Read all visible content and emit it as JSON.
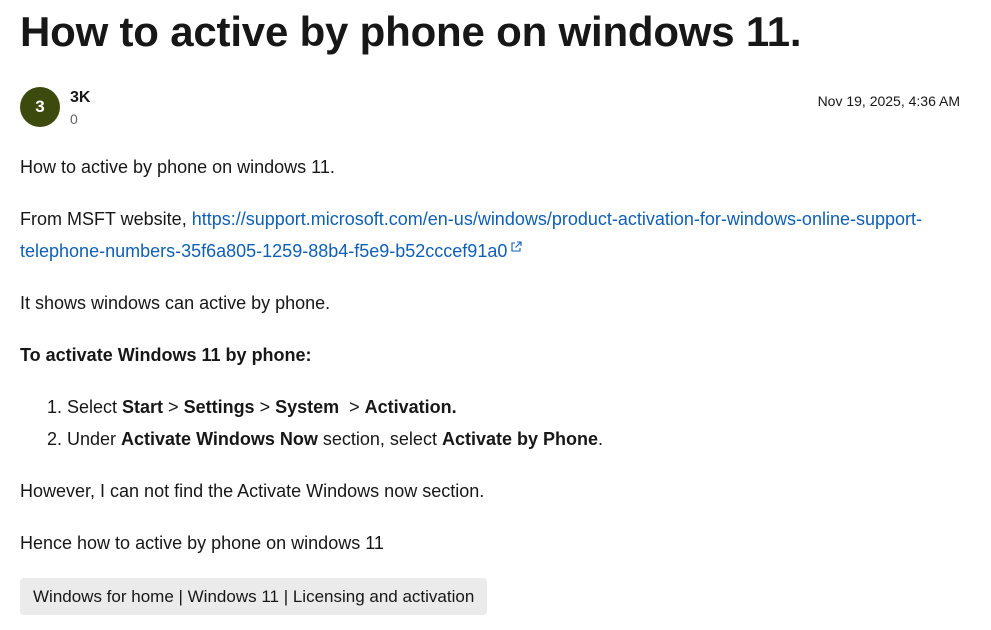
{
  "question": {
    "title": "How to active by phone on windows 11."
  },
  "author": {
    "avatar_initial": "3",
    "name": "3K",
    "reputation": "0",
    "date": "Nov 19, 2025, 4:36 AM"
  },
  "body": {
    "p1": "How to active by phone on windows 11.",
    "p2_prefix": "From MSFT website, ",
    "p2_link": "https://support.microsoft.com/en-us/windows/product-activation-for-windows-online-support-telephone-numbers-35f6a805-1259-88b4-f5e9-b52cccef91a0",
    "p3": "It shows windows can active by phone.",
    "p4": "To activate Windows 11 by phone:",
    "step1": {
      "prefix": "Select ",
      "start": "Start",
      "sep1": " > ",
      "settings": "Settings",
      "sep2": " > ",
      "system": "System",
      "sep3": "  > ",
      "activation": "Activation."
    },
    "step2": {
      "prefix": "Under ",
      "section": "Activate Windows Now",
      "middle": " section, select ",
      "action": "Activate by Phone",
      "suffix": "."
    },
    "p5": "However, I can not find the Activate Windows now section.",
    "p6": "Hence how to active by phone on windows 11"
  },
  "tags": {
    "label": "Windows for home | Windows 11 | Licensing and activation"
  },
  "colors": {
    "link": "#0f5fb7",
    "avatar_bg": "#3d4a0d",
    "tag_bg": "#ebebeb"
  },
  "icons": {
    "external_link": "external-link-icon"
  }
}
